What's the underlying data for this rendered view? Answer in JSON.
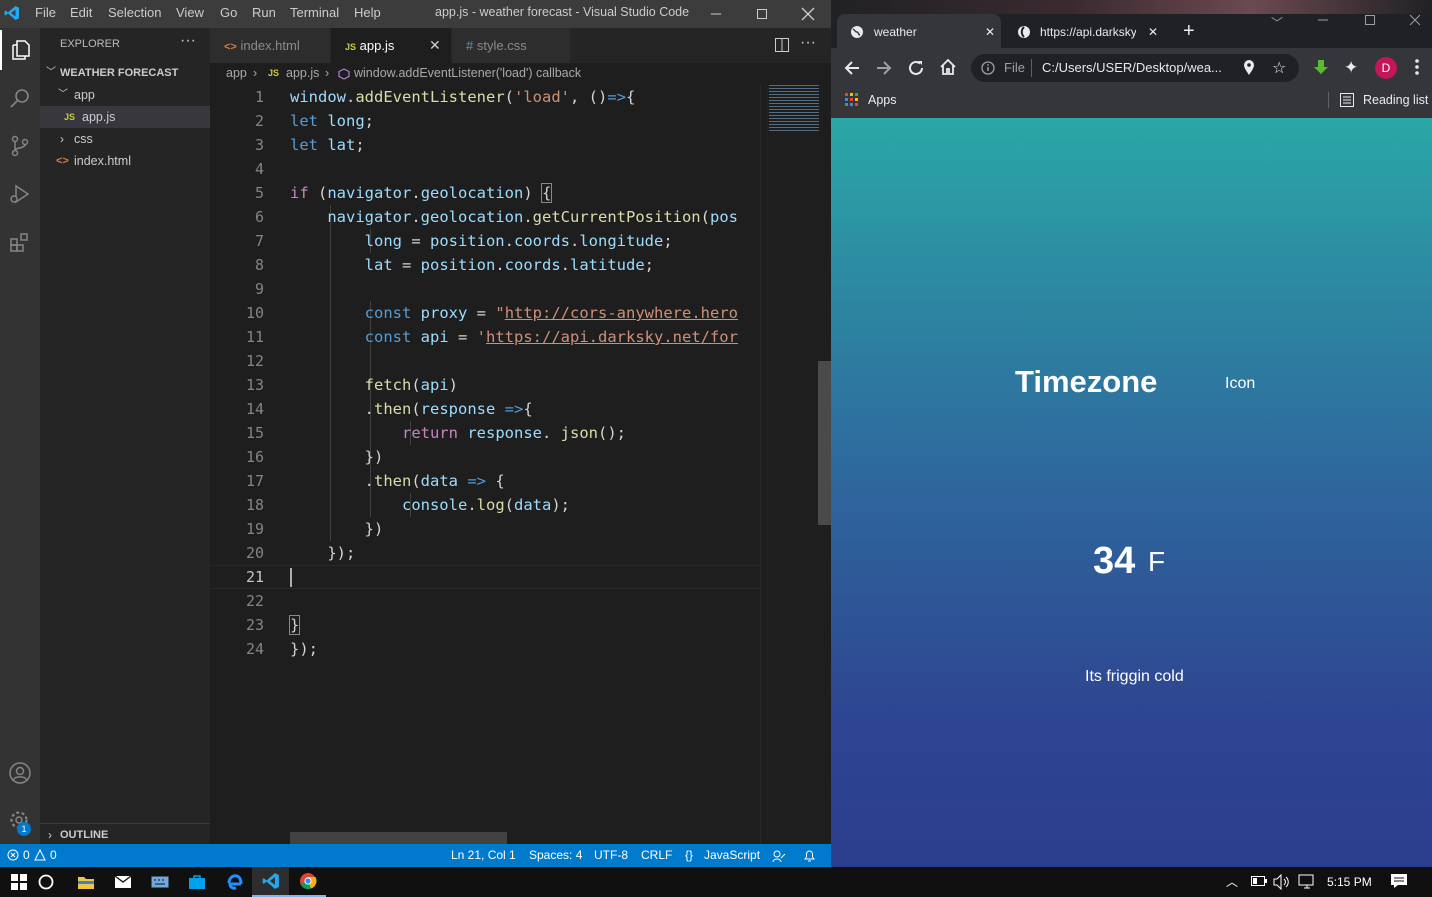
{
  "vscode": {
    "window_title": "app.js - weather forecast - Visual Studio Code",
    "menu": [
      "File",
      "Edit",
      "Selection",
      "View",
      "Go",
      "Run",
      "Terminal",
      "Help"
    ],
    "explorer": {
      "title": "EXPLORER",
      "project": "WEATHER FORECAST",
      "items": [
        {
          "label": "app",
          "kind": "folder-open"
        },
        {
          "label": "app.js",
          "kind": "js"
        },
        {
          "label": "css",
          "kind": "folder-closed"
        },
        {
          "label": "index.html",
          "kind": "html"
        }
      ],
      "outline": "OUTLINE"
    },
    "tabs": [
      {
        "label": "index.html",
        "kind": "html"
      },
      {
        "label": "app.js",
        "kind": "js"
      },
      {
        "label": "style.css",
        "kind": "css"
      }
    ],
    "breadcrumb": [
      "app",
      "app.js",
      "window.addEventListener('load') callback"
    ],
    "code_lines": [
      "window.addEventListener('load', ()=>{",
      "let long;",
      "let lat;",
      "",
      "if (navigator.geolocation) {",
      "    navigator.geolocation.getCurrentPosition(pos",
      "        long = position.coords.longitude;",
      "        lat = position.coords.latitude;",
      "",
      "        const proxy = \"http://cors-anywhere.hero",
      "        const api = 'https://api.darksky.net/for",
      "",
      "        fetch(api)",
      "        .then(response =>{",
      "            return response. json();",
      "        })",
      "        .then(data => {",
      "            console.log(data);",
      "        })",
      "    });",
      "",
      "",
      "}",
      "});"
    ],
    "current_line": 21,
    "status": {
      "errors": "0",
      "warnings": "0",
      "position": "Ln 21, Col 1",
      "spaces": "Spaces: 4",
      "encoding": "UTF-8",
      "eol": "CRLF",
      "language": "JavaScript",
      "settings_badge": "1"
    }
  },
  "chrome": {
    "tabs": [
      {
        "label": "weather",
        "icon": "globe-icon"
      },
      {
        "label": "https://api.darksky",
        "icon": "darksky-icon"
      }
    ],
    "address_scheme": "File",
    "address": "C:/Users/USER/Desktop/wea...",
    "profile_initial": "D",
    "bookmarks": {
      "apps": "Apps",
      "reading_list": "Reading list"
    },
    "page": {
      "timezone": "Timezone",
      "icon_text": "Icon",
      "degree": "34",
      "unit": "F",
      "description": "Its friggin cold"
    }
  },
  "taskbar": {
    "time": "5:15 PM"
  },
  "colors": {
    "vscode_accent": "#007acc",
    "page_top": "#2aa7a6",
    "page_bottom": "#2b3e8d",
    "profile": "#c2185b"
  }
}
